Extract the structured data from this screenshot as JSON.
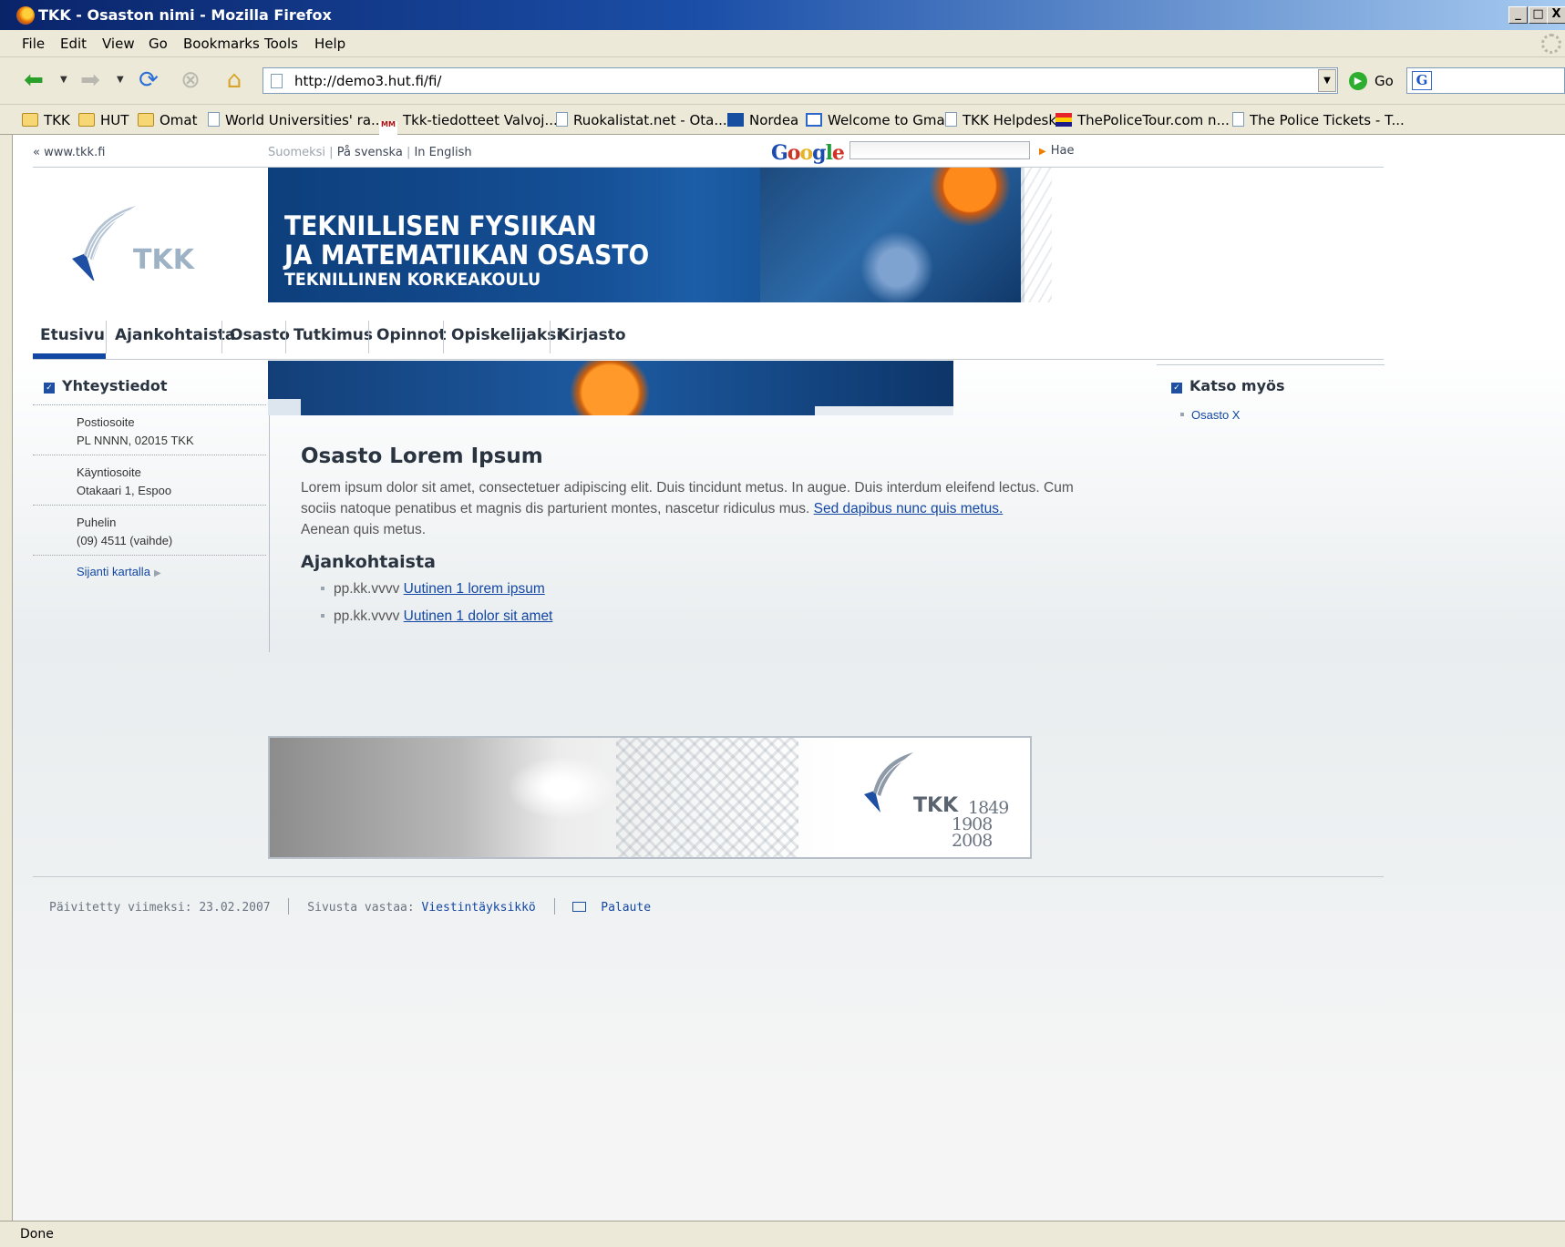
{
  "window": {
    "title": "TKK - Osaston nimi - Mozilla Firefox",
    "controls": [
      "_",
      "□",
      "X"
    ]
  },
  "menu": [
    "File",
    "Edit",
    "View",
    "Go",
    "Bookmarks",
    "Tools",
    "Help"
  ],
  "toolbar": {
    "url": "http://demo3.hut.fi/fi/",
    "go_label": "Go",
    "search_value": ""
  },
  "bookmarks": [
    {
      "label": "TKK",
      "icon": "folder-icon"
    },
    {
      "label": "HUT",
      "icon": "folder-icon"
    },
    {
      "label": "Omat",
      "icon": "folder-icon"
    },
    {
      "label": "World Universities' ra...",
      "icon": "page-icon"
    },
    {
      "label": "Tkk-tiedotteet Valvoj...",
      "icon": "mailman-icon"
    },
    {
      "label": "Ruokalistat.net - Ota...",
      "icon": "page-icon"
    },
    {
      "label": "Nordea",
      "icon": "nordea-icon"
    },
    {
      "label": "Welcome to Gmail",
      "icon": "gmail-icon"
    },
    {
      "label": "TKK Helpdesk",
      "icon": "page-icon"
    },
    {
      "label": "ThePoliceTour.com n...",
      "icon": "police-icon"
    },
    {
      "label": "The Police Tickets - T...",
      "icon": "page-icon"
    }
  ],
  "page": {
    "back_link": "« www.tkk.fi",
    "languages": [
      "Suomeksi",
      "På svenska",
      "In English"
    ],
    "google_logo": "Google",
    "search_button": "Hae",
    "logo_text": "TKK",
    "banner": {
      "line1": "TEKNILLISEN FYSIIKAN",
      "line2": "JA MATEMATIIKAN OSASTO",
      "line3": "TEKNILLINEN KORKEAKOULU"
    },
    "nav": [
      "Etusivu",
      "Ajankohtaista",
      "Osasto",
      "Tutkimus",
      "Opinnot",
      "Opiskelijaksi",
      "Kirjasto"
    ],
    "nav_active": "Etusivu",
    "contact": {
      "heading": "Yhteystiedot",
      "postal_label": "Postiosoite",
      "postal_value": "PL NNNN, 02015 TKK",
      "visit_label": "Käyntiosoite",
      "visit_value": "Otakaari 1, Espoo",
      "phone_label": "Puhelin",
      "phone_value": "(09) 4511 (vaihde)",
      "map_link": "Sijanti kartalla"
    },
    "main": {
      "title": "Osasto Lorem Ipsum",
      "paragraph": "Lorem ipsum dolor sit amet, consectetuer adipiscing elit. Duis tincidunt metus. In augue. Duis interdum eleifend lectus. Cum sociis natoque penatibus et magnis dis parturient montes, nascetur ridiculus mus.",
      "paragraph_link": "Sed dapibus nunc quis metus.",
      "paragraph_tail": "Aenean quis metus.",
      "news_heading": "Ajankohtaista",
      "news": [
        {
          "date": "pp.kk.vvvv",
          "link": "Uutinen 1 lorem ipsum"
        },
        {
          "date": "pp.kk.vvvv",
          "link": "Uutinen 1 dolor sit amet"
        }
      ]
    },
    "see_also": {
      "heading": "Katso myös",
      "links": [
        "Osasto X"
      ]
    },
    "footer_banner": {
      "logo_text": "TKK",
      "year1": "1849",
      "year2": "1908",
      "year3": "2008"
    },
    "footer": {
      "updated": "Päivitetty viimeksi: 23.02.2007",
      "responsible_label": "Sivusta vastaa:",
      "responsible_link": "Viestintäyksikkö",
      "feedback": "Palaute"
    }
  },
  "status": "Done",
  "colors": {
    "accent": "#1347a4",
    "banner_blue": "#154f95",
    "heading": "#2a3440"
  }
}
